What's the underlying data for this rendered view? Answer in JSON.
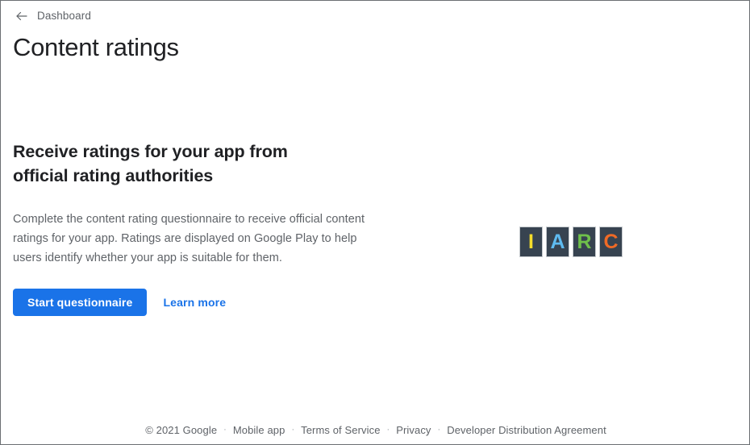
{
  "breadcrumb": {
    "back_icon": "arrow-left-icon",
    "label": "Dashboard"
  },
  "header": {
    "title": "Content ratings"
  },
  "promo": {
    "heading": "Receive ratings for your app from official rating authorities",
    "body": "Complete the content rating questionnaire to receive official content ratings for your app. Ratings are displayed on Google Play to help users identify whether your app is suitable for them.",
    "primary_button": "Start questionnaire",
    "secondary_link": "Learn more"
  },
  "logo": {
    "name": "iarc-logo",
    "tile_background": "#374350",
    "tile_border": "#c6cace",
    "letters": [
      {
        "char": "I",
        "color": "#f5dd2b"
      },
      {
        "char": "A",
        "color": "#5fbbf0"
      },
      {
        "char": "R",
        "color": "#6fc04a"
      },
      {
        "char": "C",
        "color": "#ef6a26"
      }
    ]
  },
  "footer": {
    "copyright": "© 2021 Google",
    "separator": "·",
    "links": [
      "Mobile app",
      "Terms of Service",
      "Privacy",
      "Developer Distribution Agreement"
    ]
  },
  "colors": {
    "accent_blue": "#1a73e8",
    "text_primary": "#202124",
    "text_secondary": "#5f6368"
  }
}
